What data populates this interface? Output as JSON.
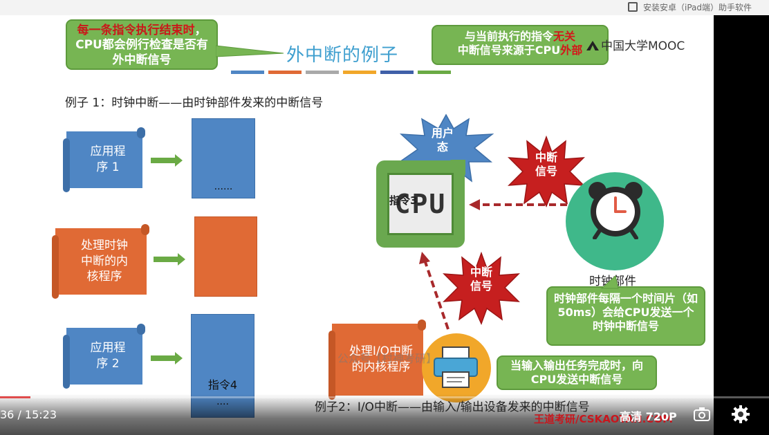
{
  "top_bar": {
    "text": "安装安卓（iPad端）助手软件"
  },
  "slide": {
    "title": "外中断的例子",
    "logo": "中国大学MOOC",
    "color_bars": [
      "#4f86c4",
      "#e06a35",
      "#a9a9a9",
      "#f1a72a",
      "#3f5fa8",
      "#6aaa44"
    ],
    "callout_left": {
      "prefix": "每一条指令执行结束",
      "red": "时",
      "rest": "，CPU都会例行检查是否有外中断信号"
    },
    "callout_right": {
      "line1_prefix": "与当前执行的指令",
      "line1_red": "无关",
      "line2_prefix": "中断信号来源于CPU",
      "line2_red": "外部"
    },
    "heading1": "例子 1：时钟中断——由时钟部件发来的中断信号",
    "programs": [
      {
        "label": "应用程序 1",
        "color": "#4f86c4"
      },
      {
        "label": "处理时钟中断的内核程序",
        "color": "#e06a35"
      },
      {
        "label": "应用程序 2",
        "color": "#4f86c4"
      }
    ],
    "blocks": {
      "b1_text": "......",
      "b4_text1": "指令4",
      "b4_text2": "...."
    },
    "user_mode": "用户态",
    "interrupt_signal": "中断信号",
    "cpu_text": "CPU",
    "cpu_instr": "指令3",
    "clock_label": "时钟部件",
    "callout_clock": "时钟部件每隔一个时间片（如 50ms）会给CPU发送一个时钟中断信号",
    "io_program": "处理I/O中断的内核程序",
    "callout_io": "当输入输出任务完成时，向CPU发送中断信号",
    "watermark": "公众号【村神考研】",
    "heading2": "例子2：I/O中断——由输入/输出设备发来的中断信号",
    "brand": "王道考研/CSKAOYAN.COM"
  },
  "player": {
    "time": "36 / 15:23",
    "progress": 0.04,
    "quality": "高清 720P",
    "accent": "#e04b4b"
  }
}
